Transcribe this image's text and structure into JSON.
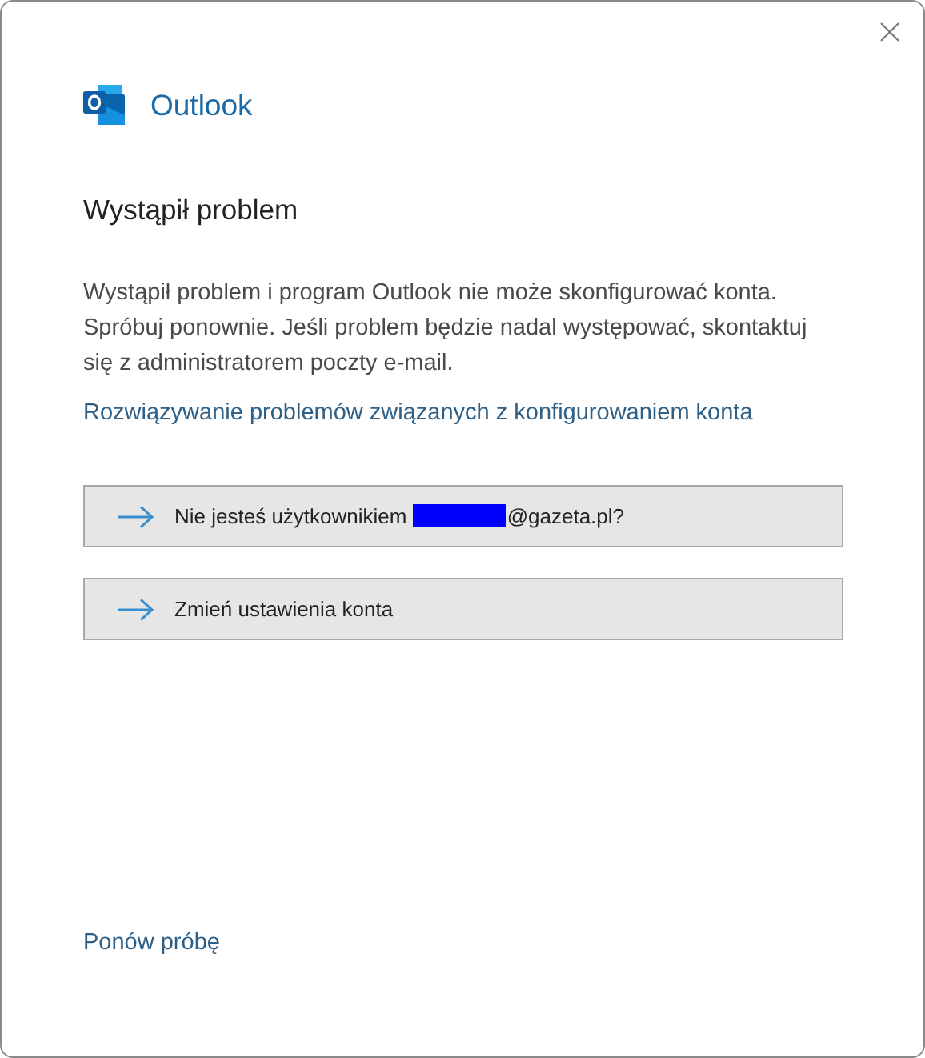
{
  "app": {
    "name": "Outlook"
  },
  "heading": "Wystąpił problem",
  "message": "Wystąpił problem i program Outlook nie może skonfigurować konta. Spróbuj ponownie. Jeśli problem będzie nadal występować, skontaktuj się z administratorem poczty e-mail.",
  "help_link": "Rozwiązywanie problemów związanych z konfigurowaniem konta",
  "actions": [
    {
      "kind": "redacted",
      "before": "Nie jesteś użytkownikiem",
      "after": "@gazeta.pl?"
    },
    {
      "kind": "plain",
      "label": "Zmień ustawienia konta"
    }
  ],
  "retry_link": "Ponów próbę"
}
